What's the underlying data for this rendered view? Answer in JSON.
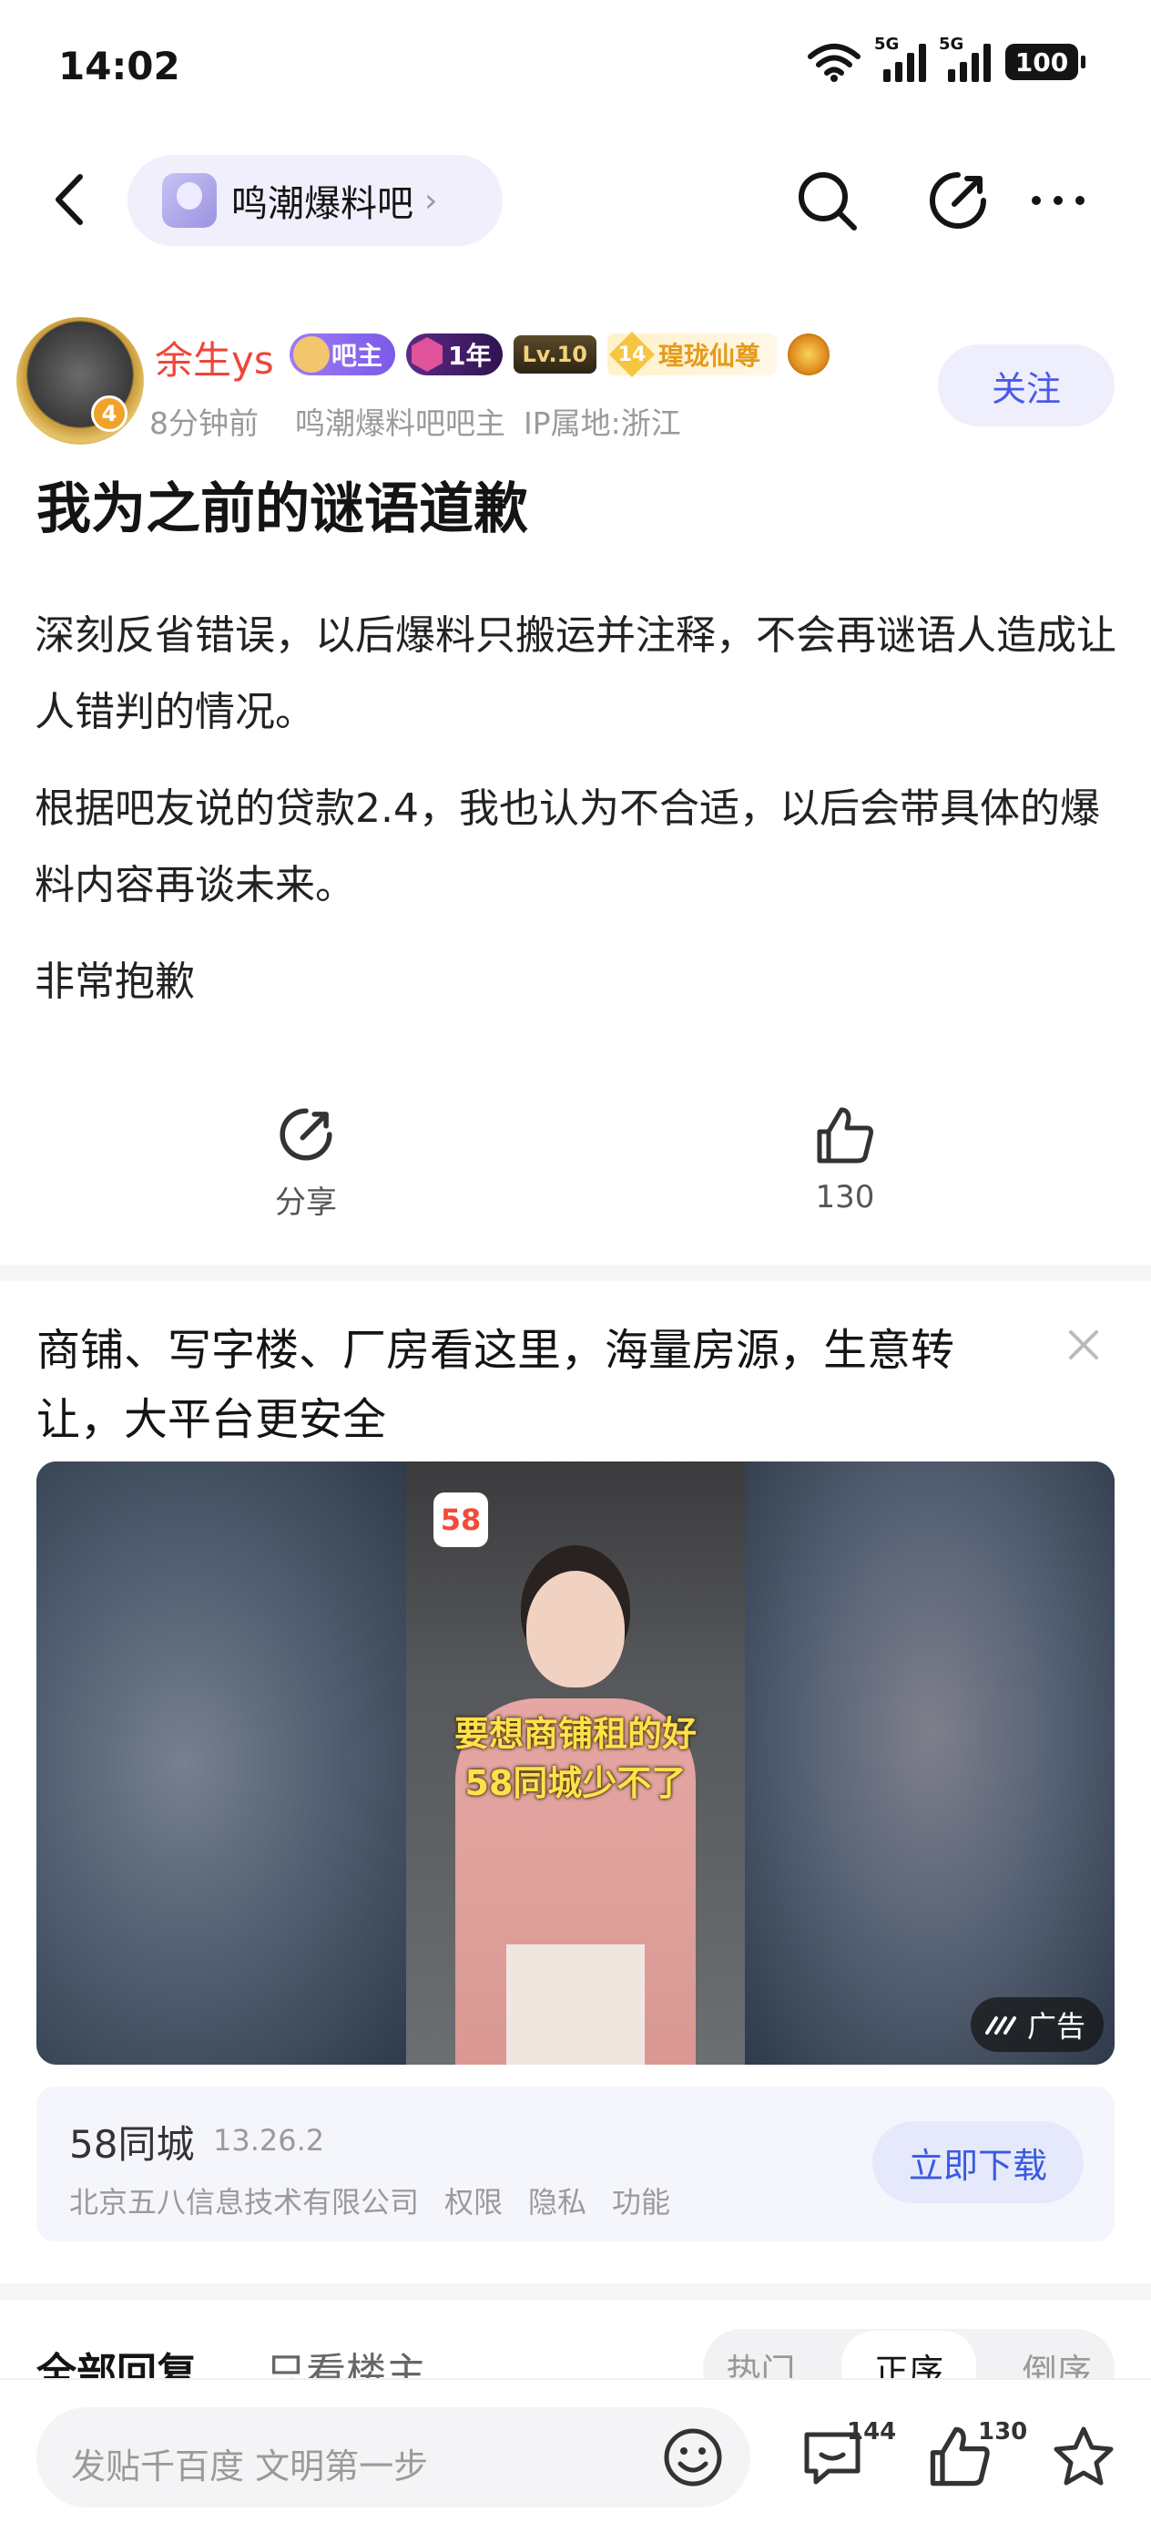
{
  "status_bar": {
    "time": "14:02",
    "network_1": "5G",
    "network_2": "5G",
    "battery": "100"
  },
  "nav": {
    "forum_name": "鸣潮爆料吧"
  },
  "author": {
    "name": "余生ys",
    "avatar_level": "4",
    "badge_owner": "吧主",
    "badge_year": "1年",
    "badge_level": "Lv.10",
    "badge_fairy_num": "14",
    "badge_fairy": "瑝珑仙尊",
    "time_ago": "8分钟前",
    "role": "鸣潮爆料吧吧主",
    "ip": "IP属地:浙江",
    "follow_label": "关注"
  },
  "post": {
    "title": "我为之前的谜语道歉",
    "paragraphs": [
      "深刻反省错误，以后爆料只搬运并注释，不会再谜语人造成让人错判的情况。",
      "根据吧友说的贷款2.4，我也认为不合适，以后会带具体的爆料内容再谈未来。",
      "非常抱歉"
    ]
  },
  "actions": {
    "share_label": "分享",
    "like_count": "130"
  },
  "ad": {
    "headline": "商铺、写字楼、厂房看这里，海量房源，生意转让，大平台更安全",
    "video_logo": "58",
    "video_caption_1": "要想商铺租的好",
    "video_caption_2": "58同城少不了",
    "tag": "广告",
    "app_name": "58同城",
    "app_version": "13.26.2",
    "company": "北京五八信息技术有限公司",
    "links": [
      "权限",
      "隐私",
      "功能"
    ],
    "download_label": "立即下载"
  },
  "replies": {
    "tab_all": "全部回复",
    "tab_op": "只看楼主",
    "sort": [
      "热门",
      "正序",
      "倒序"
    ]
  },
  "bottom_bar": {
    "placeholder": "发贴千百度 文明第一步",
    "comment_count": "144",
    "like_count": "130"
  }
}
